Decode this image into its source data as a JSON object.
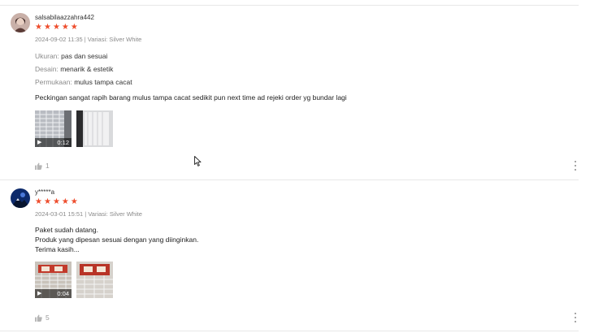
{
  "reviews": [
    {
      "username": "salsabilaazzahra442",
      "stars": "★★★★★",
      "meta": "2024-09-02 11:35 | Variasi: Silver White",
      "attributes": [
        {
          "key": "Ukuran:",
          "value": "pas dan sesuai"
        },
        {
          "key": "Desain:",
          "value": "menarik & estetik"
        },
        {
          "key": "Permukaan:",
          "value": "mulus tampa cacat"
        }
      ],
      "comment": "Peckingan sangat rapih barang mulus tampa cacat sedikit pun next time ad rejeki order yg bundar lagi",
      "video_duration": "0:12",
      "likes": "1"
    },
    {
      "username": "y*****a",
      "stars": "★★★★★",
      "meta": "2024-03-01 15:51 | Variasi: Silver White",
      "comment_lines": [
        "Paket sudah datang.",
        "Produk yang dipesan sesuai dengan yang diinginkan.",
        "Terima kasih..."
      ],
      "video_duration": "0:04",
      "likes": "5"
    }
  ],
  "icons": {
    "star": "★",
    "camera": "▶",
    "thumbs_up": "thumbs-up-icon",
    "more": "more-vertical-icon",
    "cursor": "mouse-cursor-icon"
  },
  "colors": {
    "star": "#ee4d2d",
    "muted": "#8a8a8a",
    "divider": "#e8e8e8"
  }
}
